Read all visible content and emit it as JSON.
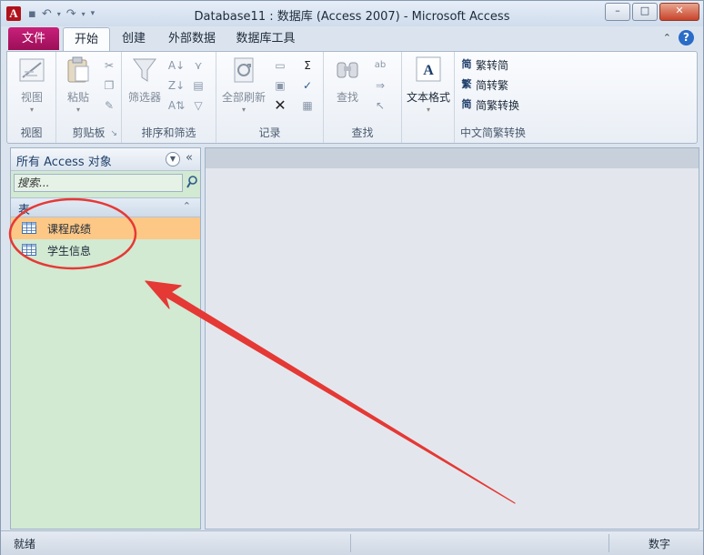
{
  "window": {
    "title": "Database11 : 数据库 (Access 2007) - Microsoft Access",
    "app_icon_letter": "A",
    "controls": {
      "minimize": "–",
      "maximize": "□",
      "close": "✕"
    }
  },
  "tabs": {
    "file": "文件",
    "items": [
      "开始",
      "创建",
      "外部数据",
      "数据库工具"
    ],
    "active": "开始"
  },
  "ribbon": {
    "view": {
      "button": "视图",
      "group": "视图"
    },
    "clipboard": {
      "button": "粘贴",
      "group": "剪贴板"
    },
    "sort_filter": {
      "button": "筛选器",
      "group": "排序和筛选"
    },
    "records": {
      "button": "全部刷新",
      "group": "记录",
      "sum_icon": "Σ"
    },
    "find": {
      "button": "查找",
      "group": "查找"
    },
    "text_format": {
      "button": "文本格式",
      "icon_letter": "A"
    },
    "chinese": {
      "items": [
        "繁转简",
        "简转繁",
        "简繁转换"
      ],
      "group": "中文简繁转换"
    }
  },
  "nav": {
    "title": "所有 Access 对象",
    "search_placeholder": "搜索...",
    "category": "表",
    "items": [
      {
        "label": "课程成绩",
        "selected": true
      },
      {
        "label": "学生信息",
        "selected": false
      }
    ]
  },
  "status": {
    "left": "就绪",
    "mode": "数字"
  },
  "colors": {
    "file_tab": "#b0166a",
    "nav_background": "#d2e9d2",
    "selected_item": "#fdc886",
    "annotation": "#e53935"
  }
}
